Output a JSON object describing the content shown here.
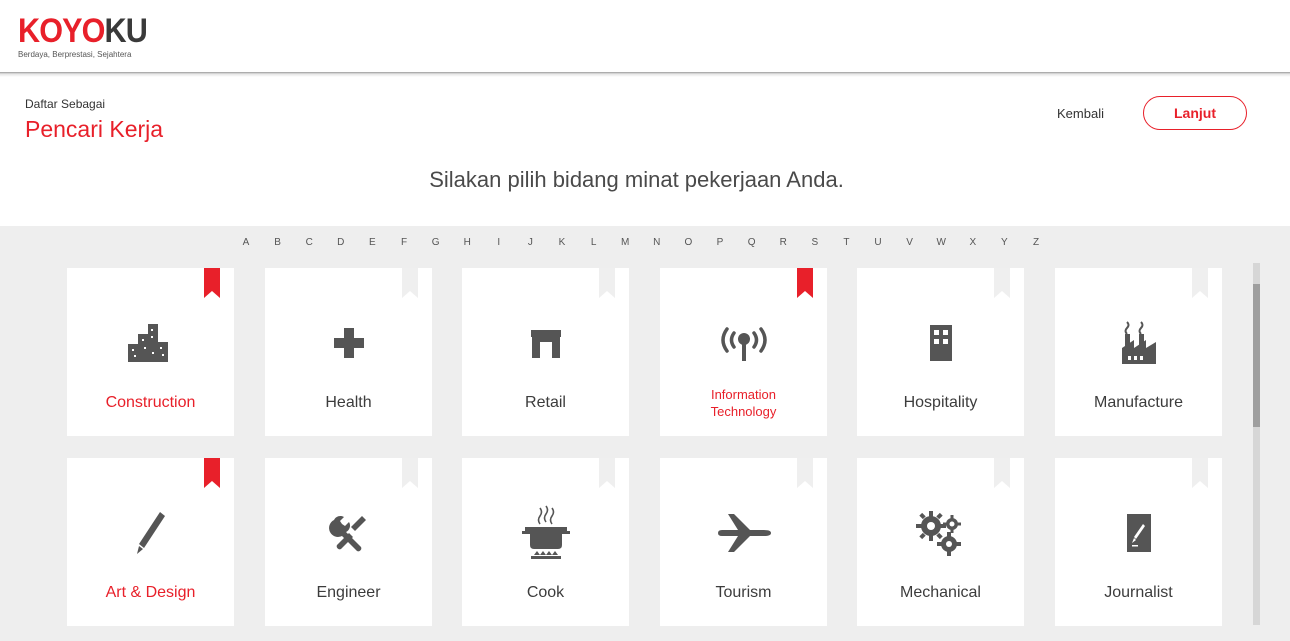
{
  "brand": {
    "logo_part1": "KOYO",
    "logo_part2": "KU",
    "tagline": "Berdaya, Berprestasi, Sejahtera"
  },
  "register": {
    "label": "Daftar Sebagai",
    "role": "Pencari Kerja"
  },
  "nav": {
    "back_label": "Kembali",
    "next_label": "Lanjut"
  },
  "prompt": "Silakan pilih bidang minat pekerjaan Anda.",
  "alphabet": [
    "A",
    "B",
    "C",
    "D",
    "E",
    "F",
    "G",
    "H",
    "I",
    "J",
    "K",
    "L",
    "M",
    "N",
    "O",
    "P",
    "Q",
    "R",
    "S",
    "T",
    "U",
    "V",
    "W",
    "X",
    "Y",
    "Z"
  ],
  "categories": [
    {
      "label": "Construction",
      "icon": "buildings-icon",
      "selected": true
    },
    {
      "label": "Health",
      "icon": "plus-icon",
      "selected": false
    },
    {
      "label": "Retail",
      "icon": "table-icon",
      "selected": false
    },
    {
      "label": "Information Technology",
      "icon": "antenna-icon",
      "selected": true
    },
    {
      "label": "Hospitality",
      "icon": "building-icon",
      "selected": false
    },
    {
      "label": "Manufacture",
      "icon": "factory-icon",
      "selected": false
    },
    {
      "label": "Art & Design",
      "icon": "pencil-icon",
      "selected": true
    },
    {
      "label": "Engineer",
      "icon": "tools-icon",
      "selected": false
    },
    {
      "label": "Cook",
      "icon": "cooking-pot-icon",
      "selected": false
    },
    {
      "label": "Tourism",
      "icon": "airplane-icon",
      "selected": false
    },
    {
      "label": "Mechanical",
      "icon": "gears-icon",
      "selected": false
    },
    {
      "label": "Journalist",
      "icon": "notepad-pen-icon",
      "selected": false
    }
  ],
  "colors": {
    "accent": "#e8202a",
    "icon": "#555555",
    "bookmark_inactive": "#efefef",
    "panel": "#eeeeee"
  }
}
